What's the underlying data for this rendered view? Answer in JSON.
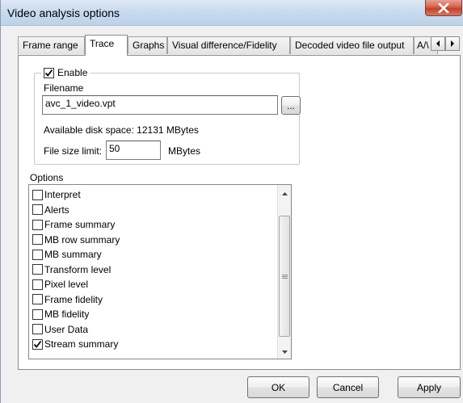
{
  "window": {
    "title": "Video analysis options",
    "close_glyph": "✕"
  },
  "tabs": [
    {
      "label": "Frame range",
      "active": false
    },
    {
      "label": "Trace",
      "active": true
    },
    {
      "label": "Graphs",
      "active": false
    },
    {
      "label": "Visual difference/Fidelity",
      "active": false
    },
    {
      "label": "Decoded video file output",
      "active": false
    },
    {
      "label": "A/\\",
      "active": false
    }
  ],
  "tab_scroll": {
    "left_icon": "tab-scroll-left-icon",
    "right_icon": "tab-scroll-right-icon"
  },
  "trace": {
    "enable_label": "Enable",
    "enable_checked": true,
    "filename_label": "Filename",
    "filename_value": "avc_1_video.vpt",
    "browse_label": "...",
    "disk_space": "Available disk space: 12131 MBytes",
    "size_limit_label": "File size limit:",
    "size_limit_value": "50",
    "size_limit_unit": "MBytes"
  },
  "options": {
    "label": "Options",
    "items": [
      {
        "label": "Interpret",
        "checked": false
      },
      {
        "label": "Alerts",
        "checked": false
      },
      {
        "label": "Frame summary",
        "checked": false
      },
      {
        "label": "MB row summary",
        "checked": false
      },
      {
        "label": "MB summary",
        "checked": false
      },
      {
        "label": "Transform level",
        "checked": false
      },
      {
        "label": "Pixel level",
        "checked": false
      },
      {
        "label": "Frame fidelity",
        "checked": false
      },
      {
        "label": "MB fidelity",
        "checked": false
      },
      {
        "label": "User Data",
        "checked": false
      },
      {
        "label": "Stream summary",
        "checked": true
      }
    ]
  },
  "buttons": {
    "ok": "OK",
    "cancel": "Cancel",
    "apply": "Apply"
  },
  "colors": {
    "titlebar": "#c9dbef",
    "close_button": "#c2412a",
    "dialog_bg": "#f0f0f0"
  }
}
